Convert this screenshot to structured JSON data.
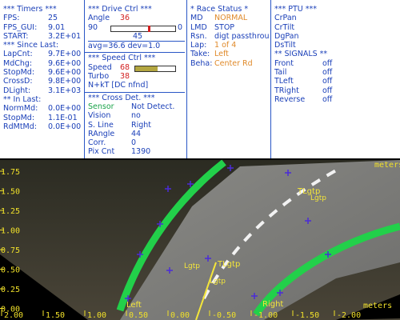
{
  "timers": {
    "title": "*** Timers ***",
    "fps_label": "FPS:",
    "fps_value": "25",
    "fps_gui_label": "FPS_GUI:",
    "fps_gui_value": "9.01",
    "start_label": "START:",
    "start_value": "3.2E+01",
    "since_title": "*** Since Last:",
    "lapcnt_label": "LapCnt:",
    "lapcnt_value": "9.7E+00",
    "mdchg_label": "MdChg:",
    "mdchg_value": "9.6E+00",
    "stopmd_label": "StopMd:",
    "stopmd_value": "9.6E+00",
    "crossd_label": "CrossD:",
    "crossd_value": "9.8E+00",
    "dlight_label": "DLight:",
    "dlight_value": "3.1E+03",
    "inlast_title": "** In Last:",
    "normmd_label": "NormMd:",
    "normmd_value": "0.0E+00",
    "stopmd2_label": "StopMd:",
    "stopmd2_value": "1.1E-01",
    "rdmtmd_label": "RdMtMd:",
    "rdmtmd_value": "0.0E+00"
  },
  "drive": {
    "title": "***  Drive Ctrl  ***",
    "angle_label": "Angle",
    "angle_value": "36",
    "bar_left": "90",
    "bar_right": "0",
    "bar_mid": "45",
    "avg_text": "avg=36.6  dev=1.0",
    "angle_level": 0.6
  },
  "speed": {
    "title": "***  Speed Ctrl  ***",
    "speed_label": "Speed",
    "speed_value": "68",
    "turbo_label": "Turbo",
    "turbo_value": "38",
    "nkt_text": "N+kT [DC nfnd]",
    "speed_level": 0.55
  },
  "cross": {
    "title": "*** Cross Det. ***",
    "sensor_label": "Sensor",
    "sensor_value": "Not Detect.",
    "vision_label": "Vision",
    "vision_value": "no",
    "sline_label": "S. Line",
    "sline_value": "Right",
    "rangle_label": "RAngle",
    "rangle_value": "44",
    "corr_label": "Corr.",
    "corr_value": "0",
    "pix_label": "Pix Cnt",
    "pix_value": "1390"
  },
  "race": {
    "title": "* Race Status *",
    "md_label": "MD",
    "md_value": "NORMAL",
    "lmd_label": "LMD",
    "lmd_value": "STOP",
    "rsn_label": "Rsn.",
    "rsn_value": "digt passthrough",
    "lap_label": "Lap:",
    "lap_value": "1 of 4",
    "take_label": "Take:",
    "take_value": "Left",
    "beha_label": "Beha:",
    "beha_value": "Center Rd"
  },
  "ptu": {
    "title": "*** PTU ***",
    "items": [
      "CrPan",
      "CrTilt",
      "DgPan",
      "DsTilt"
    ]
  },
  "signals": {
    "title": "** SIGNALS **",
    "items": [
      {
        "label": "Front",
        "value": "off"
      },
      {
        "label": "Tail",
        "value": "off"
      },
      {
        "label": "TLeft",
        "value": "off"
      },
      {
        "label": "TRight",
        "value": "off"
      },
      {
        "label": "Reverse",
        "value": "off"
      }
    ]
  },
  "camera": {
    "y_ticks": [
      "1.75",
      "1.50",
      "1.25",
      "1.00",
      "0.75",
      "0.50",
      "0.25",
      "0.00"
    ],
    "x_ticks": [
      "2.00",
      "1.50",
      "1.00",
      "0.50",
      "0.00",
      "-0.50",
      "-1.00",
      "-1.50",
      "-2.00"
    ],
    "x_unit": "meters",
    "y_unit": "meters",
    "markers": [
      {
        "label": "Left"
      },
      {
        "label": "Right"
      },
      {
        "label": "TLgtp"
      },
      {
        "label": "TLgtp"
      },
      {
        "label": "Lgtp"
      },
      {
        "label": "Lgtp"
      },
      {
        "label": "Lgtp"
      }
    ],
    "colors": {
      "lane": "#22d04a",
      "tick": "#f0e02a",
      "marker": "#4b2bd8",
      "target": "#f4e63a"
    }
  }
}
